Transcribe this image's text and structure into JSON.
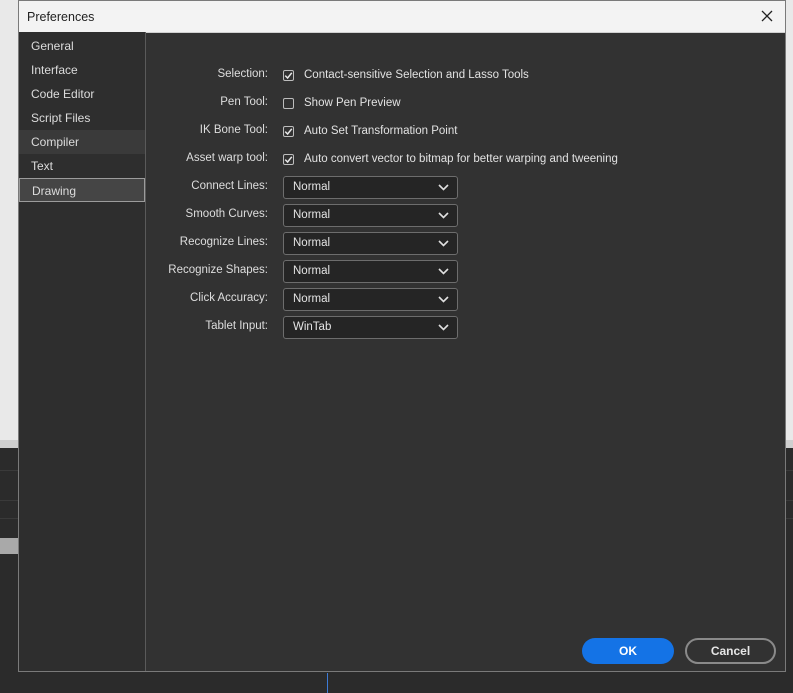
{
  "dialog": {
    "title": "Preferences"
  },
  "sidebar": {
    "items": [
      {
        "label": "General"
      },
      {
        "label": "Interface"
      },
      {
        "label": "Code Editor"
      },
      {
        "label": "Script Files"
      },
      {
        "label": "Compiler"
      },
      {
        "label": "Text"
      },
      {
        "label": "Drawing"
      }
    ],
    "selected": "Drawing"
  },
  "drawing": {
    "selection": {
      "label": "Selection:",
      "checked": true,
      "text": "Contact-sensitive Selection and Lasso Tools"
    },
    "pen_tool": {
      "label": "Pen Tool:",
      "checked": false,
      "text": "Show Pen Preview"
    },
    "ik_bone_tool": {
      "label": "IK Bone Tool:",
      "checked": true,
      "text": "Auto Set Transformation Point"
    },
    "asset_warp_tool": {
      "label": "Asset warp tool:",
      "checked": true,
      "text": "Auto convert vector to bitmap for better warping and tweening"
    },
    "connect_lines": {
      "label": "Connect Lines:",
      "value": "Normal"
    },
    "smooth_curves": {
      "label": "Smooth Curves:",
      "value": "Normal"
    },
    "recognize_lines": {
      "label": "Recognize Lines:",
      "value": "Normal"
    },
    "recognize_shapes": {
      "label": "Recognize Shapes:",
      "value": "Normal"
    },
    "click_accuracy": {
      "label": "Click Accuracy:",
      "value": "Normal"
    },
    "tablet_input": {
      "label": "Tablet Input:",
      "value": "WinTab"
    }
  },
  "buttons": {
    "ok": "OK",
    "cancel": "Cancel"
  },
  "colors": {
    "accent": "#1473e6",
    "panel": "#323232",
    "sidebar": "#2e2e2e"
  },
  "icons": {
    "close": "close-icon",
    "checkmark": "checkmark-icon",
    "dropdown": "chevron-down-icon"
  }
}
